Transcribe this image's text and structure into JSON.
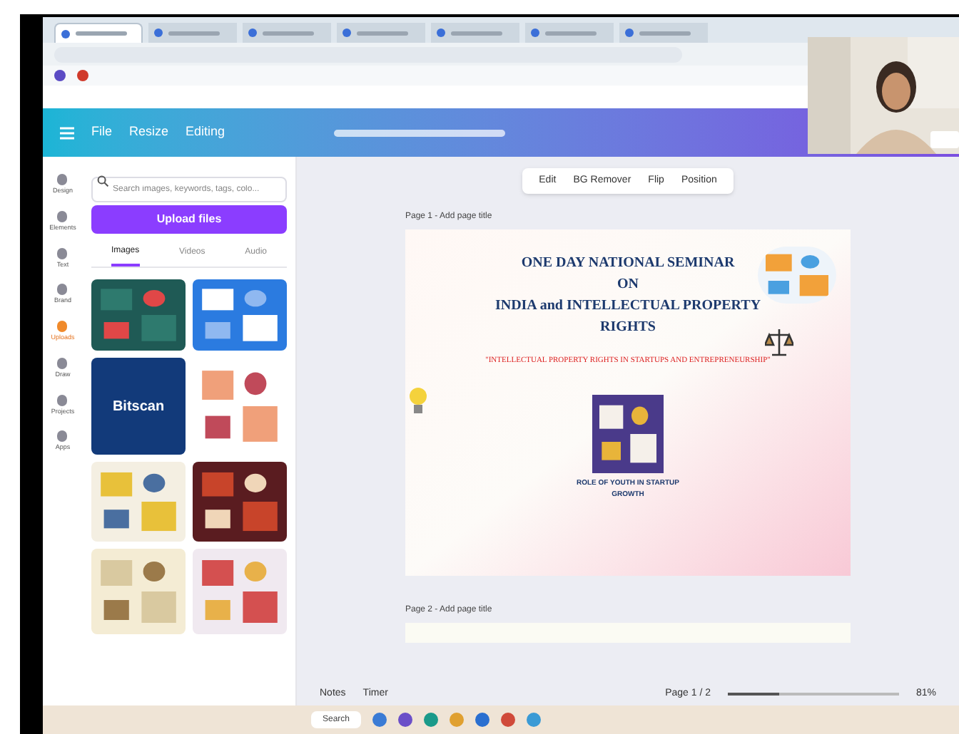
{
  "browser": {
    "tabs": [
      {
        "selected": true
      },
      {
        "selected": false
      },
      {
        "selected": false
      },
      {
        "selected": false
      },
      {
        "selected": false
      },
      {
        "selected": false
      },
      {
        "selected": false
      }
    ]
  },
  "header": {
    "menu": [
      "File",
      "Resize",
      "Editing"
    ]
  },
  "rail": [
    {
      "label": "Design",
      "selected": false
    },
    {
      "label": "Elements",
      "selected": false
    },
    {
      "label": "Text",
      "selected": false
    },
    {
      "label": "Brand",
      "selected": false
    },
    {
      "label": "Uploads",
      "selected": true
    },
    {
      "label": "Draw",
      "selected": false
    },
    {
      "label": "Projects",
      "selected": false
    },
    {
      "label": "Apps",
      "selected": false
    }
  ],
  "side_panel": {
    "search": {
      "placeholder": "Search images, keywords, tags, colo..."
    },
    "upload_button": "Upload files",
    "tabs": [
      {
        "label": "Images",
        "selected": true
      },
      {
        "label": "Videos",
        "selected": false
      },
      {
        "label": "Audio",
        "selected": false
      }
    ],
    "logo_tile": "Bitscan"
  },
  "toolbar": [
    "Edit",
    "BG Remover",
    "Flip",
    "Position"
  ],
  "pages": [
    {
      "label": "Page 1 - Add page title"
    },
    {
      "label": "Page 2 - Add page title"
    }
  ],
  "slide": {
    "title": [
      "ONE DAY NATIONAL SEMINAR",
      "ON",
      "INDIA and INTELLECTUAL PROPERTY",
      "RIGHTS"
    ],
    "subtitle": "\"INTELLECTUAL PROPERTY RIGHTS IN STARTUPS AND ENTREPRENEURSHIP\"",
    "caption": [
      "ROLE OF YOUTH IN STARTUP",
      "GROWTH"
    ]
  },
  "bottom_bar": {
    "notes": "Notes",
    "timer": "Timer",
    "page": "Page 1 / 2",
    "zoom": {
      "level": 0.3,
      "reading": "81%"
    }
  },
  "taskbar": {
    "search": "Search"
  }
}
